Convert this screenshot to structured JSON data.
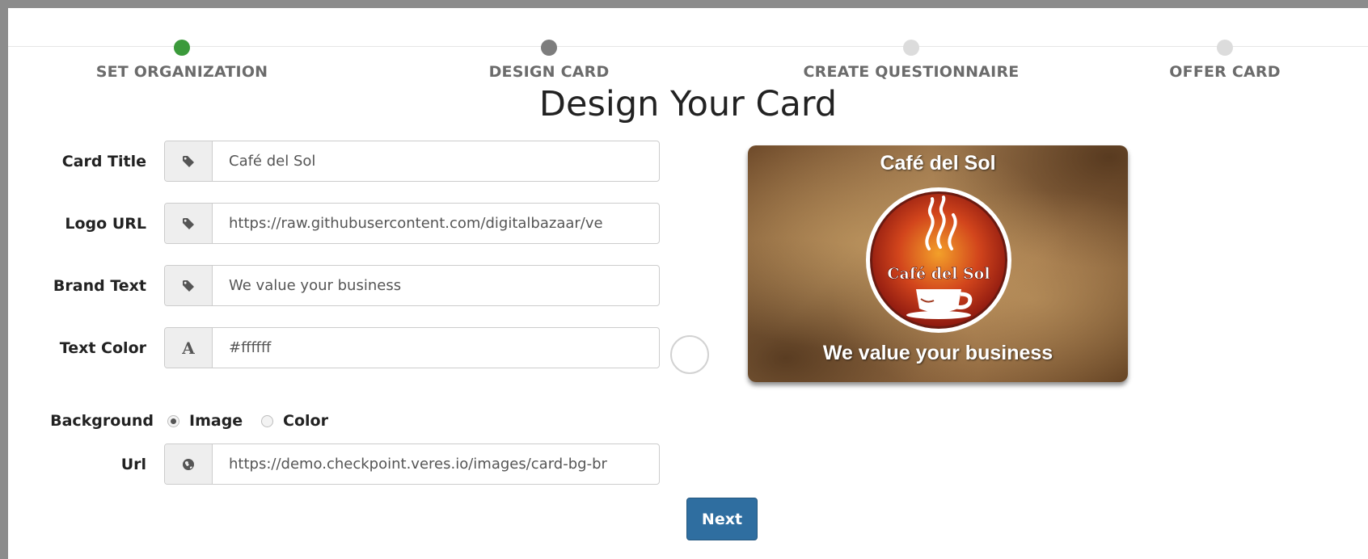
{
  "steps": [
    {
      "label": "SET ORGANIZATION",
      "state": "done"
    },
    {
      "label": "DESIGN CARD",
      "state": "current"
    },
    {
      "label": "CREATE QUESTIONNAIRE",
      "state": "pending"
    },
    {
      "label": "OFFER CARD",
      "state": "pending"
    }
  ],
  "page_title": "Design Your Card",
  "form": {
    "card_title": {
      "label": "Card Title",
      "value": "Café del Sol",
      "icon": "tag-icon"
    },
    "logo_url": {
      "label": "Logo URL",
      "value": "https://raw.githubusercontent.com/digitalbazaar/ve",
      "icon": "tag-icon"
    },
    "brand_text": {
      "label": "Brand Text",
      "value": "We value your business",
      "icon": "tag-icon"
    },
    "text_color": {
      "label": "Text Color",
      "value": "#ffffff",
      "addon": "A",
      "swatch_color": "#ffffff"
    },
    "background": {
      "label": "Background",
      "options": [
        "Image",
        "Color"
      ],
      "selected": "Image"
    },
    "url": {
      "label": "Url",
      "value": "https://demo.checkpoint.veres.io/images/card-bg-br",
      "icon": "globe-icon"
    }
  },
  "next_label": "Next",
  "card_preview": {
    "title": "Café del Sol",
    "logo_text": "Café del Sol",
    "brand_text": "We value your business",
    "text_color": "#ffffff"
  },
  "colors": {
    "step_done": "#3b9a3b",
    "step_current": "#7d7d7d",
    "step_pending": "#dcdcdc",
    "button": "#2f6ea0"
  }
}
